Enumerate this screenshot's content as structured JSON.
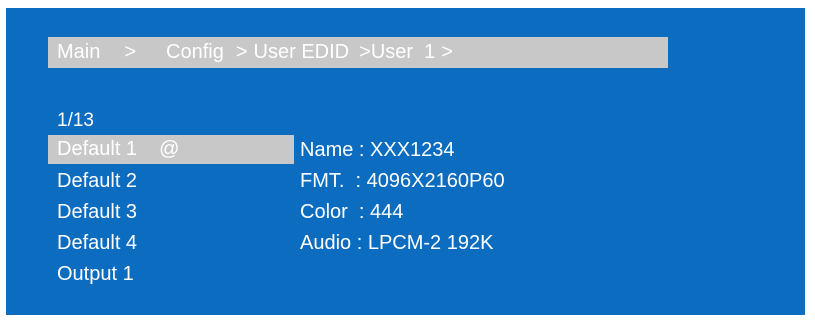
{
  "breadcrumb": {
    "items": [
      "Main",
      "Config",
      "User EDID",
      "User  1"
    ],
    "separator": ">"
  },
  "page_counter": "1/13",
  "menu": {
    "items": [
      {
        "label": "Default 1",
        "marker": "@",
        "selected": true
      },
      {
        "label": "Default 2"
      },
      {
        "label": "Default 3"
      },
      {
        "label": "Default 4"
      },
      {
        "label": "Output 1"
      }
    ]
  },
  "details": {
    "name": {
      "label": "Name",
      "value": "XXX1234"
    },
    "format": {
      "label": "FMT.",
      "value": "4096X2160P60"
    },
    "color": {
      "label": "Color",
      "value": "444"
    },
    "audio": {
      "label": "Audio",
      "value": "LPCM-2 192K"
    }
  },
  "colors": {
    "background": "#0b6cc0",
    "highlight": "#c8c8c8",
    "text": "#ffffff"
  }
}
